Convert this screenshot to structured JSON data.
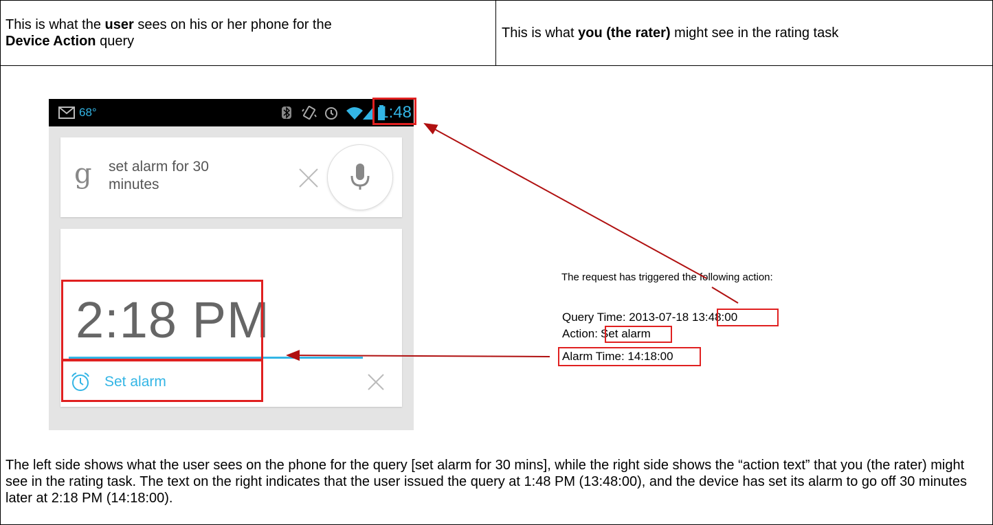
{
  "header": {
    "left_prefix": "This is what the ",
    "left_bold1": "user",
    "left_mid": " sees on his or her phone for the",
    "left_bold2": "Device Action",
    "left_suffix": " query",
    "right_prefix": "This is what ",
    "right_bold": "you (the rater)",
    "right_suffix": " might see in the rating task"
  },
  "phone": {
    "status_temp": "68°",
    "status_time": "1:48",
    "search_query_line1": "set alarm for 30",
    "search_query_line2": "minutes",
    "alarm_time": "2:18 PM",
    "alarm_action": "Set alarm",
    "icons": [
      "gmail-icon",
      "bluetooth-icon",
      "vibrate-icon",
      "alarm-clock-icon",
      "wifi-icon",
      "signal-icon",
      "battery-icon",
      "google-g-icon",
      "clear-x-icon",
      "microphone-icon",
      "alarm-icon",
      "dismiss-x-icon"
    ]
  },
  "action_text": {
    "intro": "The request has triggered the following action:",
    "query_time_label": "Query Time: 2013-07-18 ",
    "query_time_value": "13:48:00",
    "action_label": "Action:",
    "action_value": "Set alarm",
    "alarm_time_text": "Alarm Time: 14:18:00"
  },
  "footer": {
    "paragraph": "The left side shows what the user sees on the phone for the query [set alarm for 30 mins], while the right side shows the “action text” that you (the rater) might see in the rating task.  The text on the right indicates that the user issued the query at 1:48 PM (13:48:00), and the device has set its alarm to go off 30 minutes later at 2:18 PM (14:18:00)."
  },
  "colors": {
    "accent_blue": "#33b5e5",
    "highlight_red": "#e02020",
    "arrow_dark_red": "#b01010"
  }
}
